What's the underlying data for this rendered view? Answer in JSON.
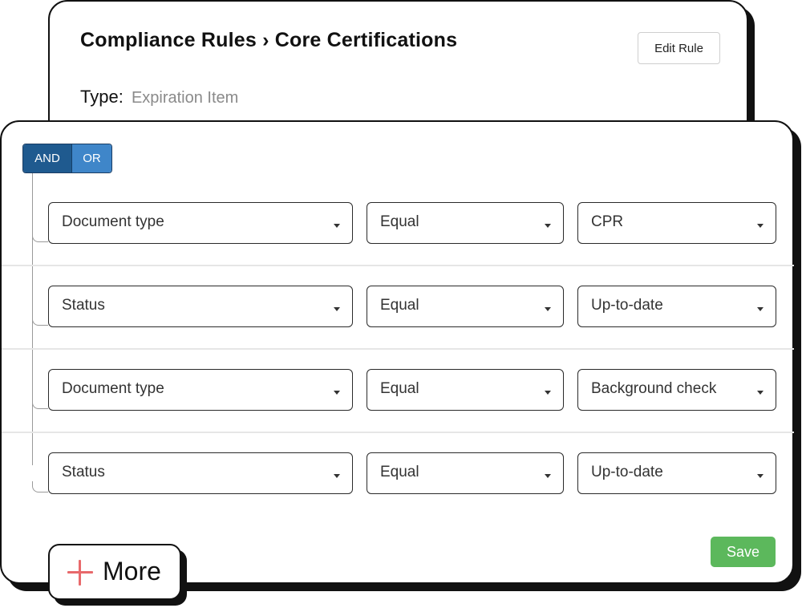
{
  "header": {
    "breadcrumb": "Compliance Rules › Core Certifications",
    "edit_button": "Edit Rule",
    "type_label": "Type:",
    "type_value": "Expiration Item"
  },
  "logic_toggle": {
    "and_label": "AND",
    "or_label": "OR",
    "selected": "AND"
  },
  "conditions": [
    {
      "field": "Document type",
      "operator": "Equal",
      "value": "CPR"
    },
    {
      "field": "Status",
      "operator": "Equal",
      "value": "Up-to-date"
    },
    {
      "field": "Document type",
      "operator": "Equal",
      "value": "Background check"
    },
    {
      "field": "Status",
      "operator": "Equal",
      "value": "Up-to-date"
    }
  ],
  "save_button": "Save",
  "more_button": "More",
  "colors": {
    "and_active": "#1f5a8f",
    "or": "#3f86c9",
    "save": "#5cb85c",
    "plus_icon": "#e8696b"
  },
  "icons": {
    "dropdown": "chevron-down-icon",
    "add": "plus-icon"
  }
}
